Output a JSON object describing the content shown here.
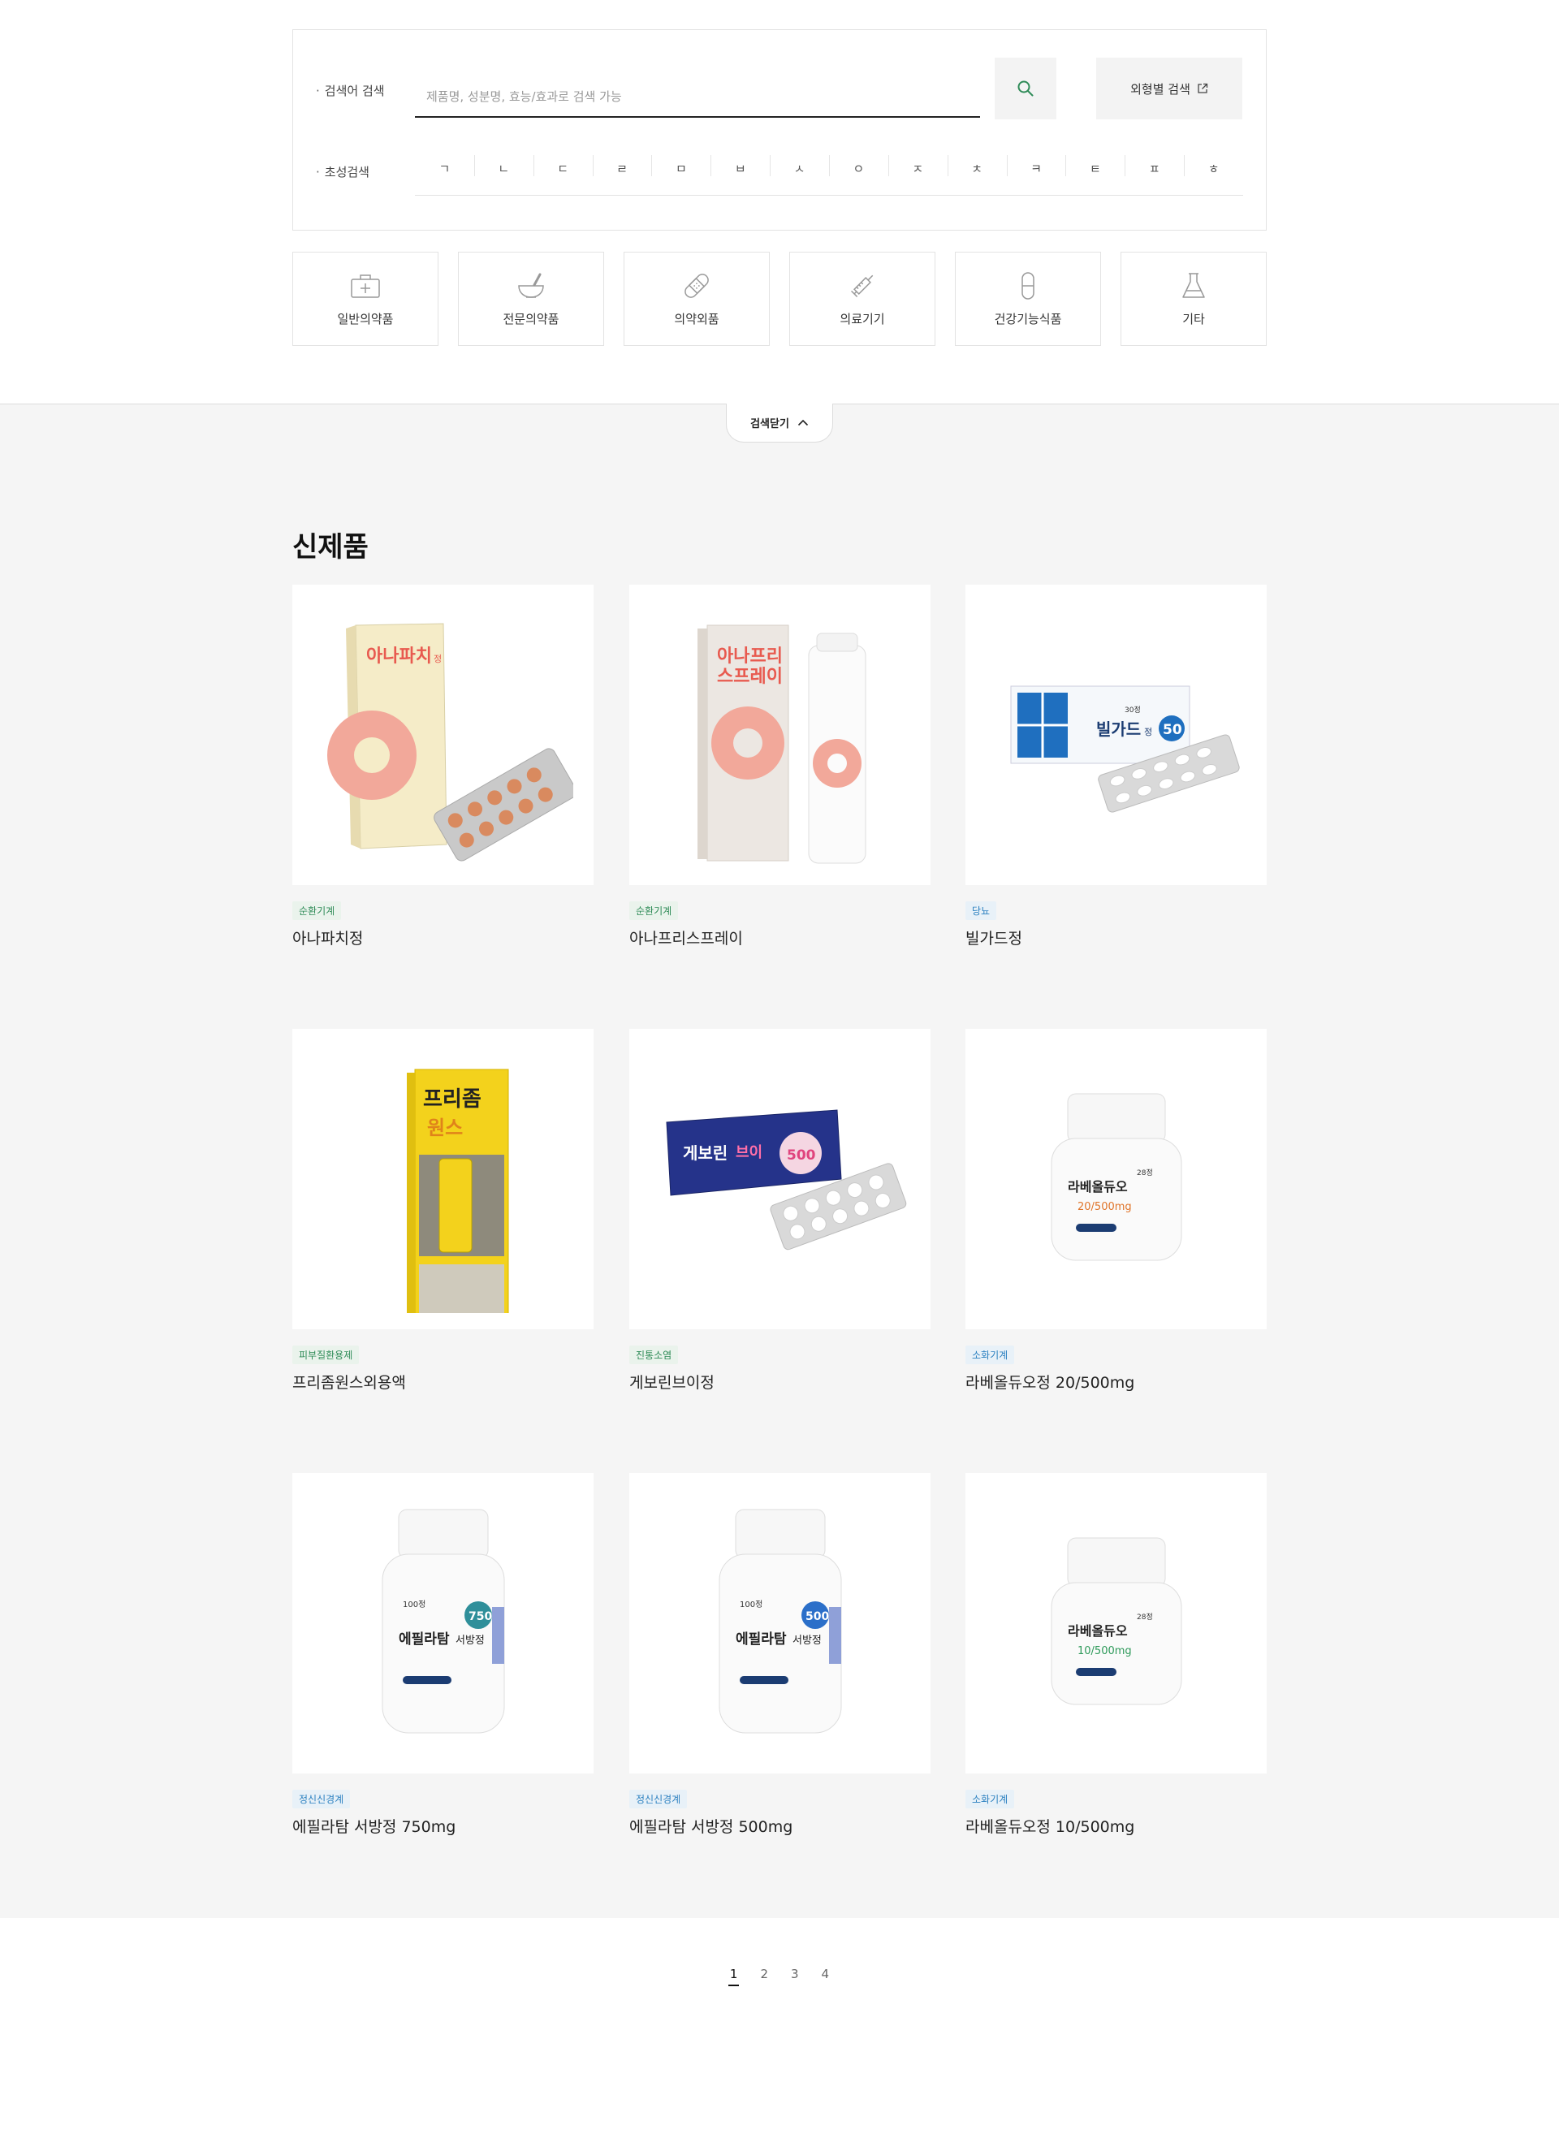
{
  "search": {
    "keyword_label": "검색어 검색",
    "keyword_placeholder": "제품명, 성분명, 효능/효과로 검색 가능",
    "keyword_value": "",
    "shape_search_label": "외형별 검색",
    "initial_label": "초성검색",
    "initials": [
      "ㄱ",
      "ㄴ",
      "ㄷ",
      "ㄹ",
      "ㅁ",
      "ㅂ",
      "ㅅ",
      "ㅇ",
      "ㅈ",
      "ㅊ",
      "ㅋ",
      "ㅌ",
      "ㅍ",
      "ㅎ"
    ]
  },
  "categories": [
    {
      "label": "일반의약품",
      "icon": "first-aid-kit-icon"
    },
    {
      "label": "전문의약품",
      "icon": "mortar-pestle-icon"
    },
    {
      "label": "의약외품",
      "icon": "bandage-icon"
    },
    {
      "label": "의료기기",
      "icon": "syringe-icon"
    },
    {
      "label": "건강기능식품",
      "icon": "capsule-icon"
    },
    {
      "label": "기타",
      "icon": "flask-icon"
    }
  ],
  "close_search_label": "검색닫기",
  "section_title": "신제품",
  "products": [
    {
      "tag": "순환기계",
      "tag_color": "green",
      "name": "아나파치정",
      "img": "box-blister"
    },
    {
      "tag": "순환기계",
      "tag_color": "green",
      "name": "아나프리스프레이",
      "img": "box-spray"
    },
    {
      "tag": "당뇨",
      "tag_color": "blue",
      "name": "빌가드정",
      "img": "blue-box-blister"
    },
    {
      "tag": "피부질환용제",
      "tag_color": "green",
      "name": "프리좀원스외용액",
      "img": "yellow-box"
    },
    {
      "tag": "진통소염",
      "tag_color": "green",
      "name": "게보린브이정",
      "img": "navy-box-blister"
    },
    {
      "tag": "소화기계",
      "tag_color": "blue",
      "name": "라베올듀오정 20/500mg",
      "img": "small-bottle"
    },
    {
      "tag": "정신신경계",
      "tag_color": "blue",
      "name": "에필라탐 서방정 750mg",
      "img": "tall-bottle"
    },
    {
      "tag": "정신신경계",
      "tag_color": "blue",
      "name": "에필라탐 서방정 500mg",
      "img": "tall-bottle"
    },
    {
      "tag": "소화기계",
      "tag_color": "blue",
      "name": "라베올듀오정 10/500mg",
      "img": "small-bottle"
    }
  ],
  "product_image_text": {
    "p0_brand": "아나파치",
    "p0_brand_suffix": "정",
    "p1_brand_line1": "아나프리",
    "p1_brand_line2": "스프레이",
    "p2_brand": "빌가드",
    "p2_suffix": "정",
    "p2_count": "30정",
    "p2_dose": "50",
    "p3_brand": "프리좀",
    "p3_sub": "원스",
    "p4_brand": "게보린",
    "p4_brand_2": "브이",
    "p4_dose": "500",
    "p5_count": "28정",
    "p5_brand": "라베올듀오",
    "p5_dose": "20/500mg",
    "p6_count": "100정",
    "p6_brand": "에필라탐",
    "p6_type": "서방정",
    "p6_dose": "750",
    "p7_count": "100정",
    "p7_brand": "에필라탐",
    "p7_type": "서방정",
    "p7_dose": "500",
    "p8_count": "28정",
    "p8_brand": "라베올듀오",
    "p8_dose": "10/500mg"
  },
  "pagination": {
    "pages": [
      "1",
      "2",
      "3",
      "4"
    ],
    "current": "1"
  },
  "colors": {
    "accent_green": "#2e8b57",
    "tag_blue": "#2b80c0",
    "bg_gray": "#f5f5f5"
  }
}
